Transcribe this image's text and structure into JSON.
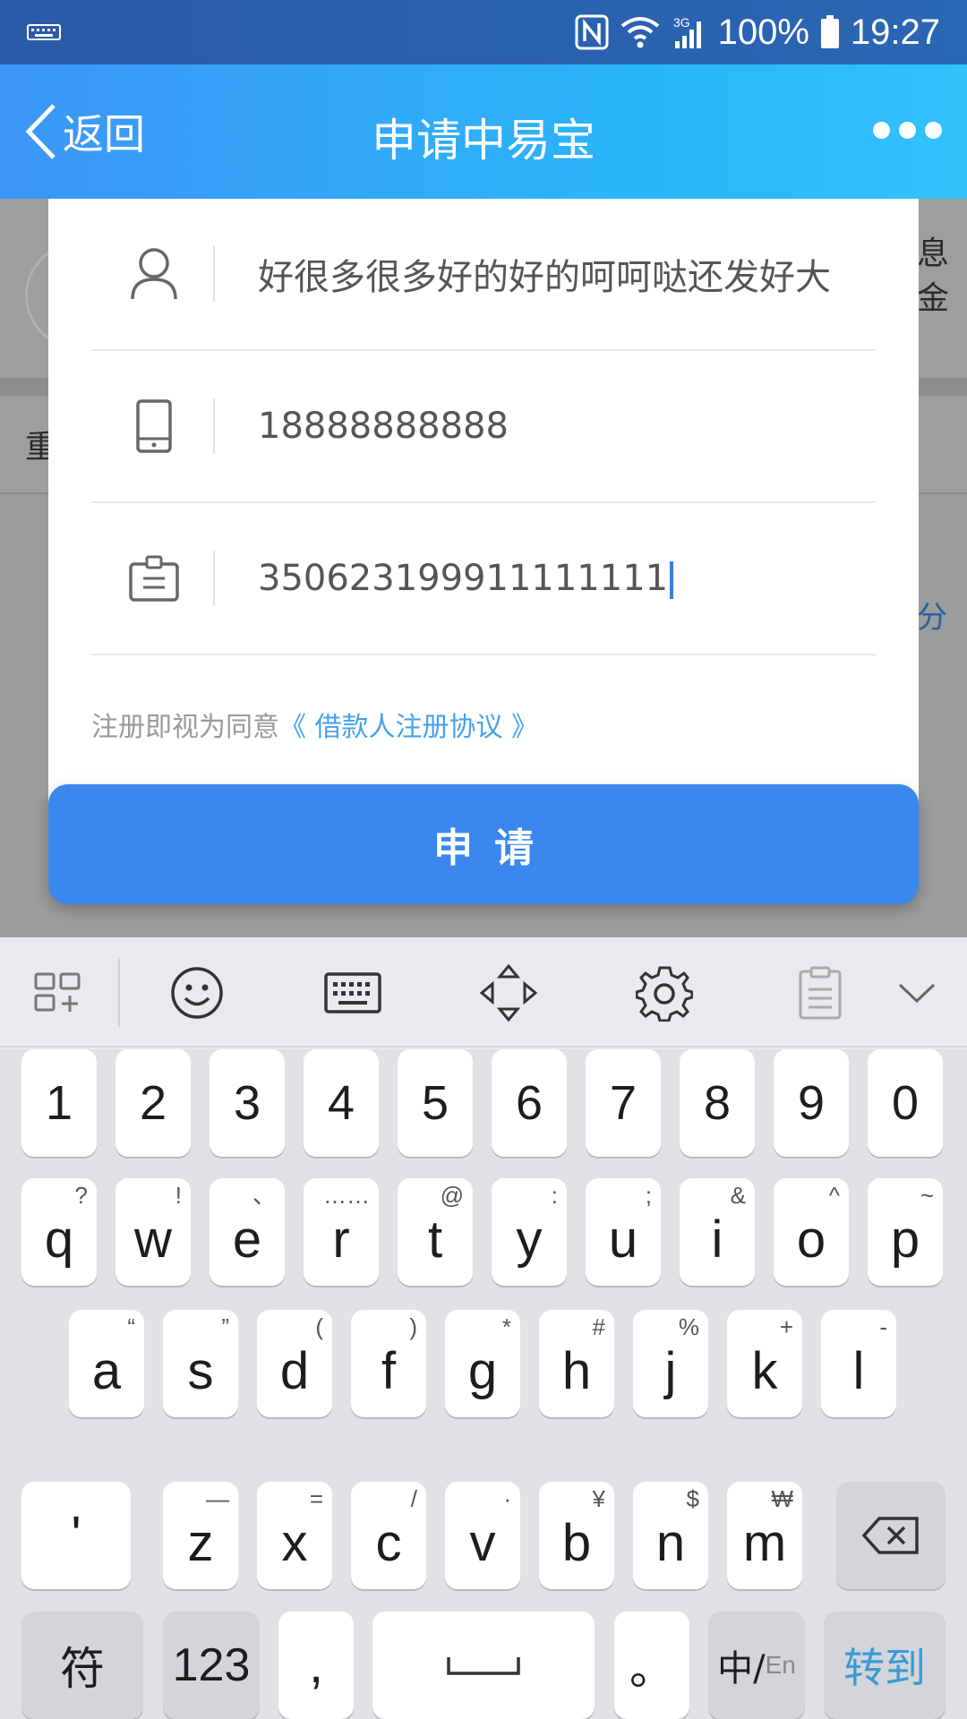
{
  "status_bar": {
    "battery": "100%",
    "time": "19:27",
    "network": "3G"
  },
  "header": {
    "back_label": "返回",
    "title": "申请中易宝"
  },
  "background_page": {
    "side_text_1": "息",
    "side_text_2": "金",
    "row_text": "重",
    "side_link": "分"
  },
  "form": {
    "name_value": "好很多很多好的好的呵呵哒还发好大",
    "phone_value": "18888888888",
    "id_value": "350623199911111111",
    "agreement_prefix": "注册即视为同意",
    "agreement_link": "《 借款人注册协议 》"
  },
  "apply_button": "申请",
  "keyboard": {
    "number_row": [
      "1",
      "2",
      "3",
      "4",
      "5",
      "6",
      "7",
      "8",
      "9",
      "0"
    ],
    "row1": [
      {
        "key": "q",
        "sub": "?"
      },
      {
        "key": "w",
        "sub": "!"
      },
      {
        "key": "e",
        "sub": "、"
      },
      {
        "key": "r",
        "sub": "……"
      },
      {
        "key": "t",
        "sub": "@"
      },
      {
        "key": "y",
        "sub": ":"
      },
      {
        "key": "u",
        "sub": ";"
      },
      {
        "key": "i",
        "sub": "&"
      },
      {
        "key": "o",
        "sub": "^"
      },
      {
        "key": "p",
        "sub": "~"
      }
    ],
    "row2": [
      {
        "key": "a",
        "sub": "“"
      },
      {
        "key": "s",
        "sub": "”"
      },
      {
        "key": "d",
        "sub": "("
      },
      {
        "key": "f",
        "sub": ")"
      },
      {
        "key": "g",
        "sub": "*"
      },
      {
        "key": "h",
        "sub": "#"
      },
      {
        "key": "j",
        "sub": "%"
      },
      {
        "key": "k",
        "sub": "+"
      },
      {
        "key": "l",
        "sub": "-"
      }
    ],
    "row3": [
      {
        "key": "z",
        "sub": "—"
      },
      {
        "key": "x",
        "sub": "="
      },
      {
        "key": "c",
        "sub": "/"
      },
      {
        "key": "v",
        "sub": "·"
      },
      {
        "key": "b",
        "sub": "¥"
      },
      {
        "key": "n",
        "sub": "$"
      },
      {
        "key": "m",
        "sub": "₩"
      }
    ],
    "apostrophe": "'",
    "symbols_label": "符",
    "numbers_label": "123",
    "comma_label": ",",
    "period_label": "。",
    "lang_zh": "中/",
    "lang_en": "En",
    "go_label": "转到",
    "toolbar_icons": [
      "layout-icon",
      "emoji-icon",
      "keyboard-icon",
      "move-cursor-icon",
      "settings-icon",
      "clipboard-icon",
      "collapse-icon"
    ]
  }
}
